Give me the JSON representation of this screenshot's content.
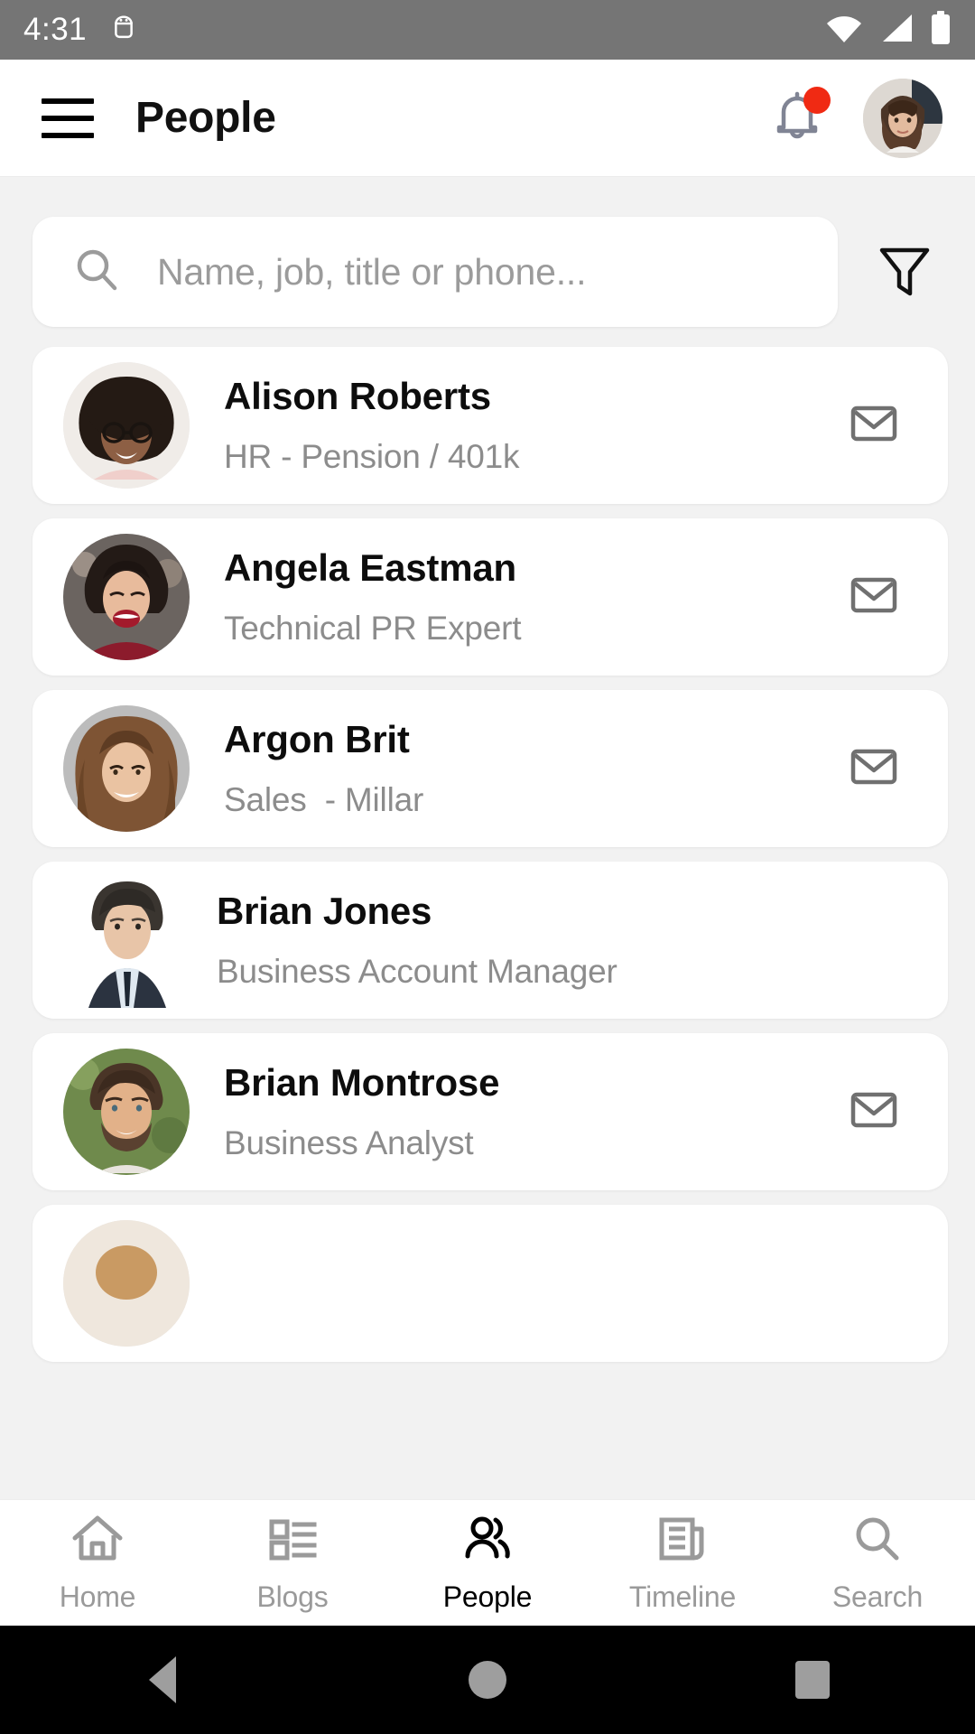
{
  "status_bar": {
    "clock": "4:31",
    "icons": [
      "android-debug-icon",
      "wifi-icon",
      "cell-signal-icon",
      "battery-icon"
    ]
  },
  "app_bar": {
    "menu_icon": "hamburger-menu-icon",
    "title": "People",
    "notification_icon": "bell-icon",
    "notification_badge": true,
    "avatar_icon": "user-avatar"
  },
  "search": {
    "icon": "search-icon",
    "placeholder": "Name, job, title or phone...",
    "value": "",
    "filter_icon": "filter-funnel-icon"
  },
  "people": [
    {
      "name": "Alison Roberts",
      "role": "HR - Pension / 401k",
      "mail_icon": "envelope-icon",
      "has_mail": true,
      "avatar_style": "circle",
      "avatar_colors": [
        "#3a2b22",
        "#c98f78",
        "#efd7d2"
      ]
    },
    {
      "name": "Angela Eastman",
      "role": "Technical PR Expert",
      "mail_icon": "envelope-icon",
      "has_mail": true,
      "avatar_style": "circle",
      "avatar_colors": [
        "#2b2420",
        "#e3b39a",
        "#8c1b2c"
      ]
    },
    {
      "name": "Argon Brit",
      "role": "Sales  - Millar",
      "mail_icon": "envelope-icon",
      "has_mail": true,
      "avatar_style": "circle",
      "avatar_colors": [
        "#b2b2b2",
        "#e6c2a4",
        "#7d5233"
      ]
    },
    {
      "name": "Brian Jones",
      "role": "Business Account Manager",
      "mail_icon": "envelope-icon",
      "has_mail": false,
      "avatar_style": "square",
      "avatar_colors": [
        "#ffffff",
        "#e8c5a8",
        "#30383f"
      ]
    },
    {
      "name": "Brian Montrose",
      "role": "Business Analyst",
      "mail_icon": "envelope-icon",
      "has_mail": true,
      "avatar_style": "circle",
      "avatar_colors": [
        "#6f8a4c",
        "#e3b48c",
        "#4a3323"
      ]
    }
  ],
  "bottom_nav": {
    "active": "People",
    "items": [
      {
        "label": "Home",
        "icon": "home-icon",
        "active": false
      },
      {
        "label": "Blogs",
        "icon": "list-grid-icon",
        "active": false
      },
      {
        "label": "People",
        "icon": "people-icon",
        "active": true
      },
      {
        "label": "Timeline",
        "icon": "newspaper-icon",
        "active": false
      },
      {
        "label": "Search",
        "icon": "search-icon",
        "active": false
      }
    ]
  },
  "android_nav": {
    "back": "back-triangle-icon",
    "home": "home-circle-icon",
    "recents": "recents-square-icon"
  },
  "colors": {
    "status_bar_bg": "#757575",
    "page_bg": "#f2f2f2",
    "card_bg": "#ffffff",
    "badge_red": "#f02a13",
    "muted_text": "#8c8c8c",
    "icon_gray": "#707070",
    "nav_inactive": "#9a9a9a",
    "nav_active": "#000000"
  }
}
